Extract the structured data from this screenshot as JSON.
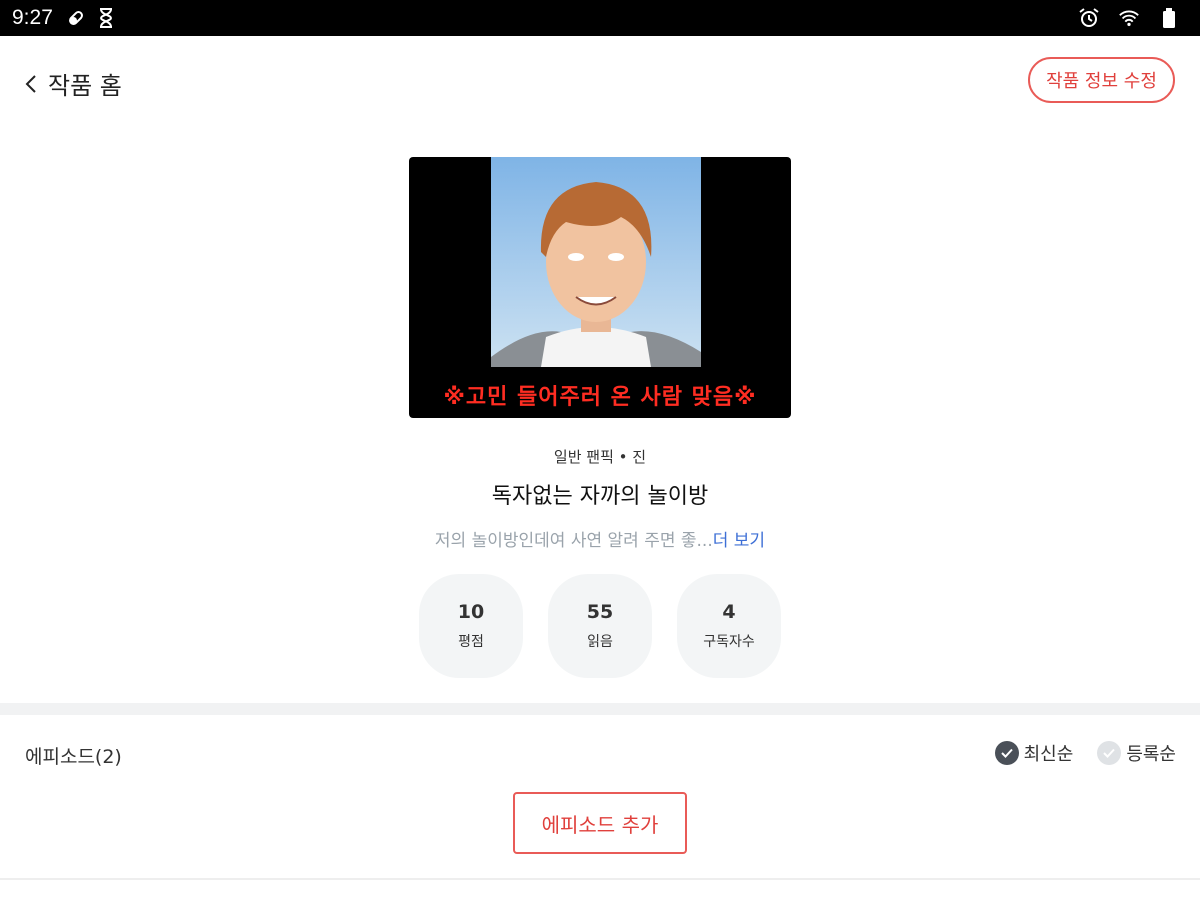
{
  "status_bar": {
    "time": "9:27",
    "icons": [
      "pill-icon",
      "hourglass-icon",
      "alarm-icon",
      "wifi-icon",
      "battery-icon"
    ]
  },
  "header": {
    "back_label": "작품 홈",
    "edit_button": "작품 정보 수정"
  },
  "cover": {
    "caption": "※고민 들어주러 온 사람 맞음※"
  },
  "work": {
    "genre": "일반 팬픽 • 진",
    "title": "독자없는 자까의 놀이방",
    "description": "저의 놀이방인데여 사연 알려 주면 좋...",
    "more_label": "더 보기"
  },
  "stats": [
    {
      "value": "10",
      "label": "평점"
    },
    {
      "value": "55",
      "label": "읽음"
    },
    {
      "value": "4",
      "label": "구독자수"
    }
  ],
  "episodes": {
    "label": "에피소드(2)",
    "sort_latest": "최신순",
    "sort_registered": "등록순",
    "active_sort": "latest",
    "add_button": "에피소드 추가"
  },
  "colors": {
    "accent": "#e95b57",
    "link": "#3d6fd6",
    "stat_bg": "#f3f5f6"
  }
}
